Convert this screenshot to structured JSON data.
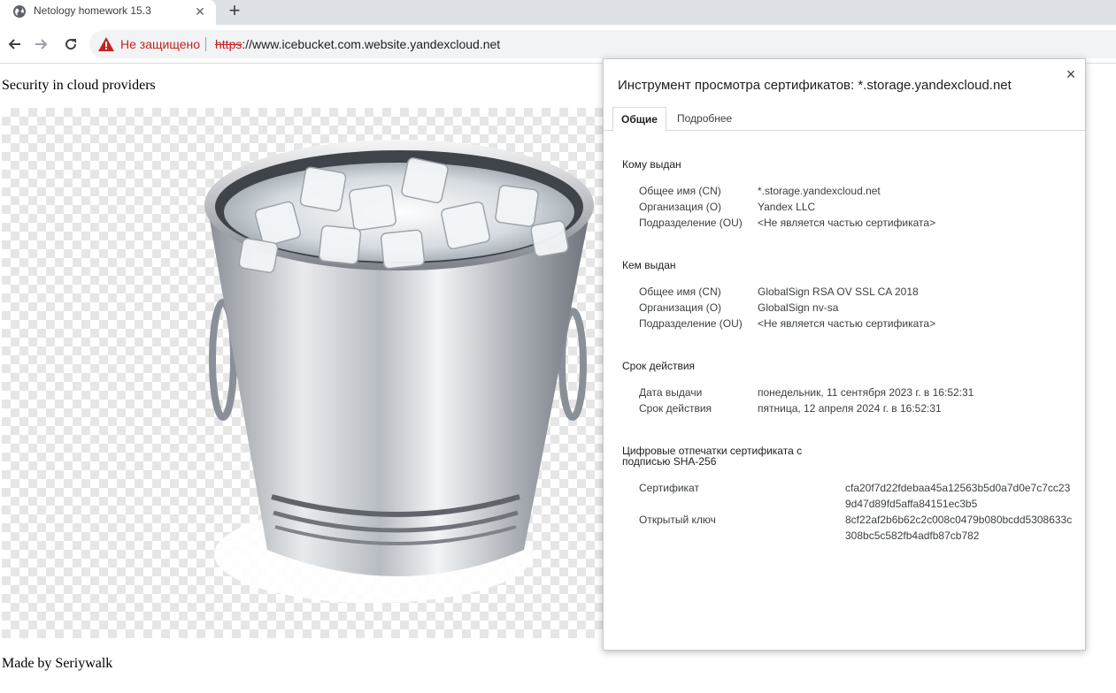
{
  "browser": {
    "tab_title": "Netology homework 15.3",
    "tab_close": "✕",
    "new_tab": "+",
    "not_secure": "Не защищено",
    "url_scheme": "https",
    "url_rest": "://www.icebucket.com.website.yandexcloud.net"
  },
  "page": {
    "heading": "Security in cloud providers",
    "footer": "Made by Seriywalk"
  },
  "dialog": {
    "title": "Инструмент просмотра сертификатов: *.storage.yandexcloud.net",
    "close": "×",
    "tabs": [
      "Общие",
      "Подробнее"
    ],
    "issued_to": {
      "title": "Кому выдан",
      "rows": [
        {
          "label": "Общее имя (CN)",
          "value": "*.storage.yandexcloud.net"
        },
        {
          "label": "Организация (O)",
          "value": "Yandex LLC"
        },
        {
          "label": "Подразделение (OU)",
          "value": "<Не является частью сертификата>"
        }
      ]
    },
    "issued_by": {
      "title": "Кем выдан",
      "rows": [
        {
          "label": "Общее имя (CN)",
          "value": "GlobalSign RSA OV SSL CA 2018"
        },
        {
          "label": "Организация (O)",
          "value": "GlobalSign nv-sa"
        },
        {
          "label": "Подразделение (OU)",
          "value": "<Не является частью сертификата>"
        }
      ]
    },
    "validity": {
      "title": "Срок действия",
      "rows": [
        {
          "label": "Дата выдачи",
          "value": "понедельник, 11 сентября 2023 г. в 16:52:31"
        },
        {
          "label": "Срок действия",
          "value": "пятница, 12 апреля 2024 г. в 16:52:31"
        }
      ]
    },
    "fingerprints": {
      "title_line1": "Цифровые отпечатки сертификата с",
      "title_line2": "подписью SHA-256",
      "rows": [
        {
          "label": "Сертификат",
          "value": "cfa20f7d22fdebaa45a12563b5d0a7d0e7c7cc239d47d89fd5affa84151ec3b5"
        },
        {
          "label": "Открытый ключ",
          "value": "8cf22af2b6b62c2c008c0479b080bcdd5308633c308bc5c582fb4adfb87cb782"
        }
      ]
    }
  },
  "colors": {
    "warning_red": "#c5221f",
    "tabstrip_bg": "#dee1e6"
  }
}
